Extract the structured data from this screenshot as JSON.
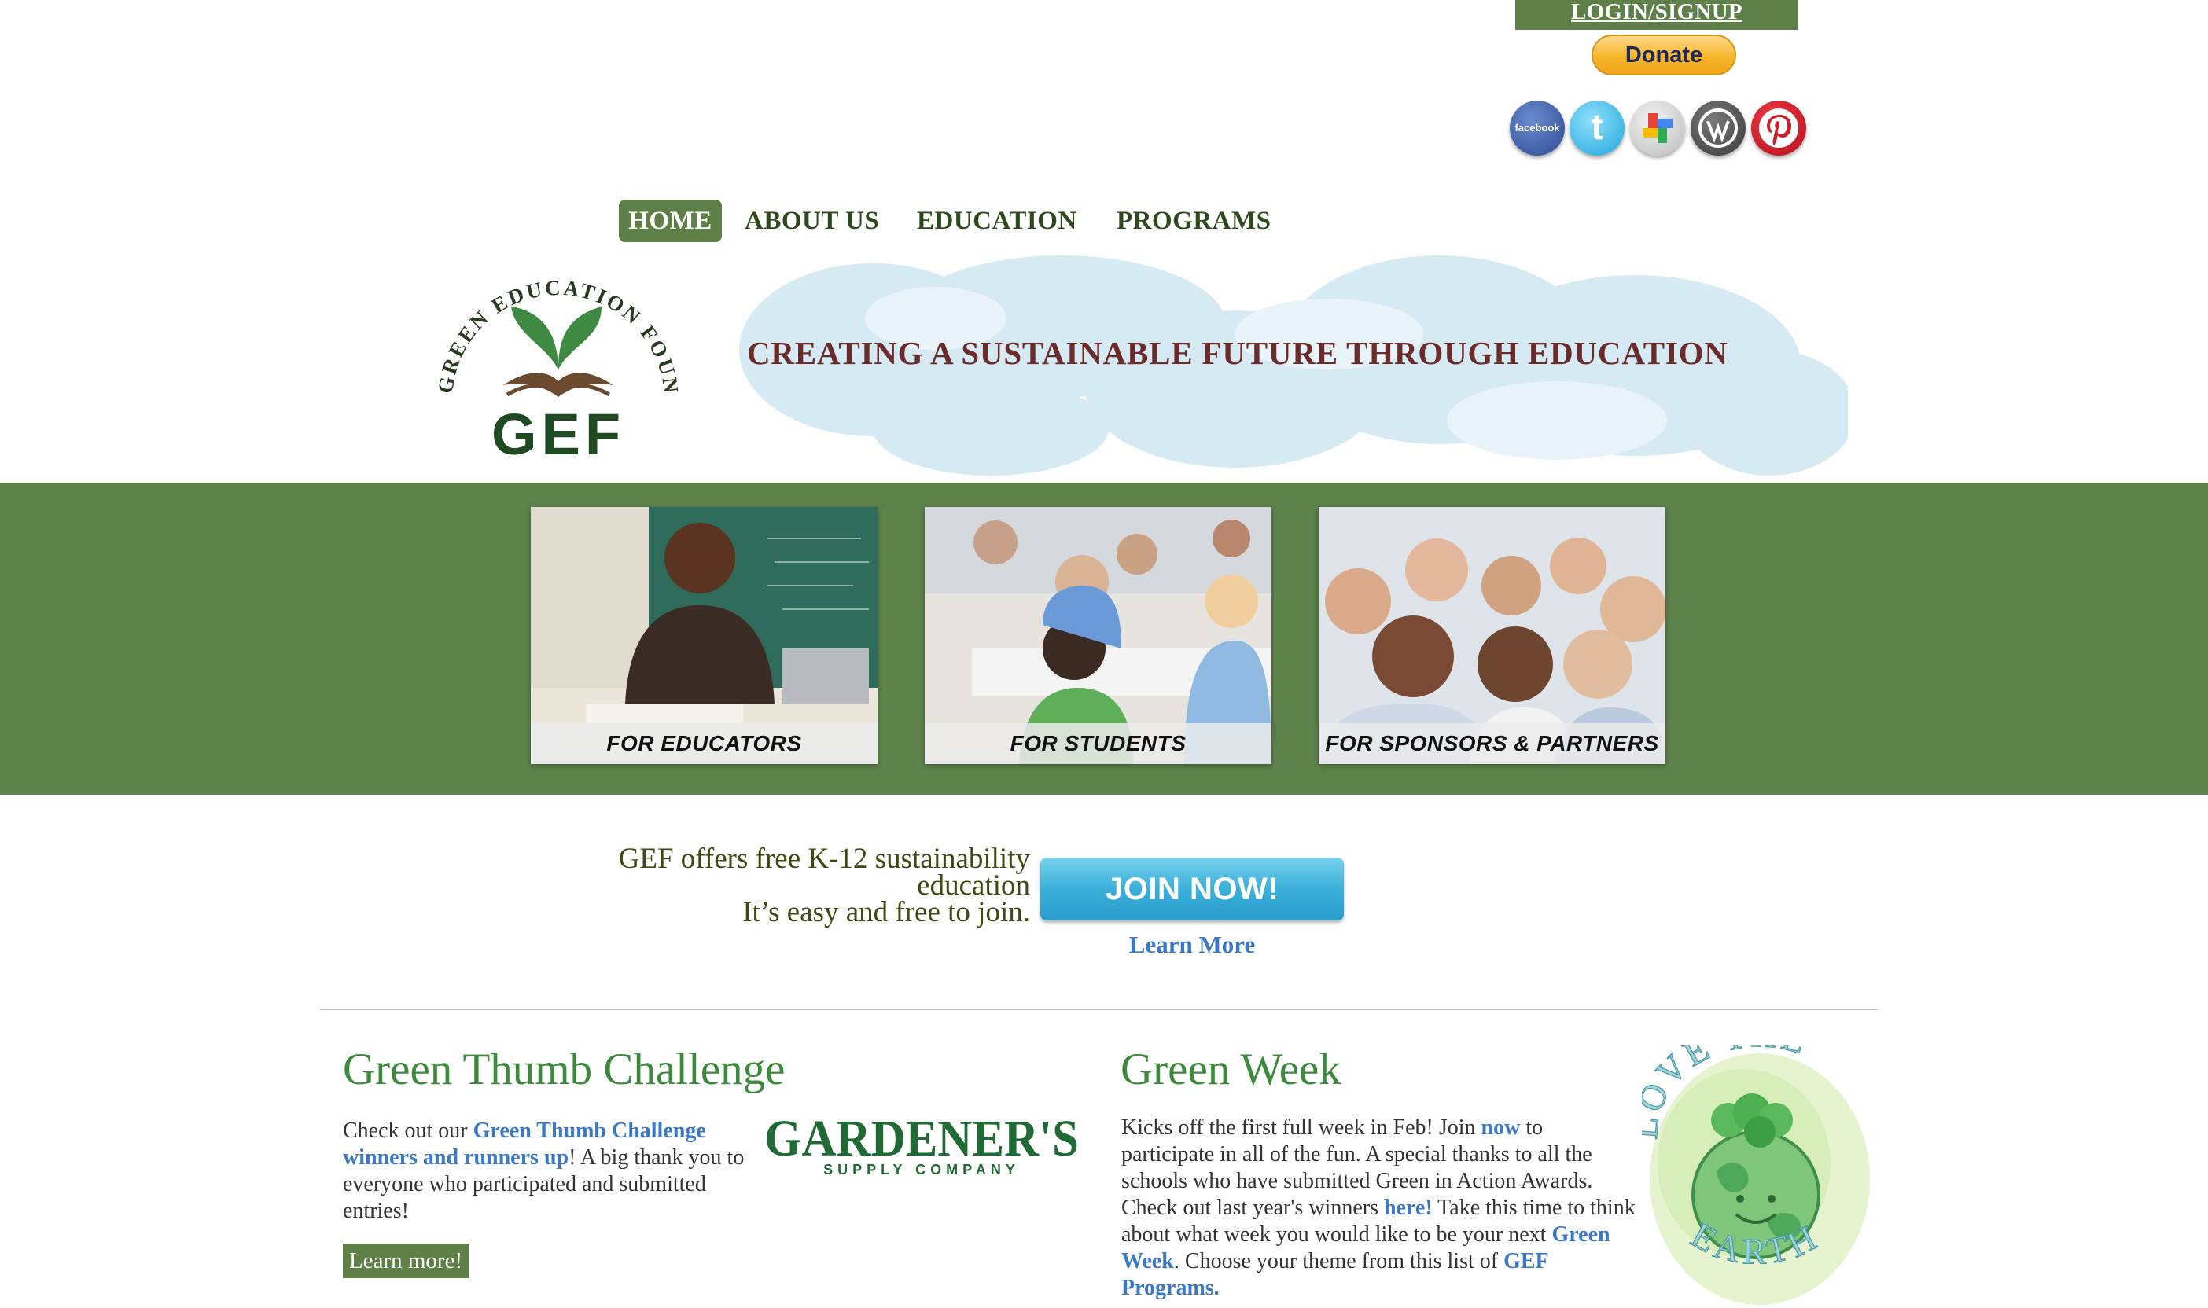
{
  "utility": {
    "login_label": "LOGIN/SIGNUP",
    "donate_label": "Donate",
    "social": [
      "facebook",
      "twitter",
      "google-plus",
      "wordpress",
      "pinterest"
    ],
    "facebook_text": "facebook",
    "twitter_text": "t"
  },
  "nav": {
    "items": [
      {
        "label": "HOME",
        "active": true
      },
      {
        "label": "ABOUT US",
        "active": false
      },
      {
        "label": "EDUCATION",
        "active": false
      },
      {
        "label": "PROGRAMS",
        "active": false
      }
    ]
  },
  "banner": {
    "logo_arc_text": "GREEN EDUCATION FOUNDATION",
    "logo_text": "GEF",
    "tagline": "CREATING A SUSTAINABLE FUTURE THROUGH EDUCATION"
  },
  "cards": [
    {
      "label": "FOR EDUCATORS"
    },
    {
      "label": "FOR STUDENTS"
    },
    {
      "label": "FOR SPONSORS & PARTNERS"
    }
  ],
  "join": {
    "line1": "GEF offers free K-12 sustainability",
    "line2": "education",
    "line3": "It’s easy and free to join.",
    "button": "JOIN NOW!",
    "learn_more": "Learn More"
  },
  "green_thumb": {
    "title": "Green Thumb Challenge",
    "text_before": "Check out our ",
    "link": "Green Thumb Challenge winners and runners up",
    "text_after": "! A big thank you to everyone who participated and submitted entries!",
    "sponsor_name": "GARDENER'S",
    "sponsor_sub": "SUPPLY COMPANY",
    "learn_more": "Learn more!"
  },
  "green_week": {
    "title": "Green Week",
    "t1": "Kicks off the first full week in Feb! Join ",
    "link_now": "now",
    "t2": " to participate in all of the fun. A special thanks to all the schools who have submitted Green in Action Awards. Check out last year's winners ",
    "link_here": "here!",
    "t3": " Take this time to think about what week you would like to be your next ",
    "link_gw": "Green Week",
    "t4": ".  Choose your theme from this list of ",
    "link_programs": "GEF Programs.",
    "image_text_top": "LOVE THE",
    "image_text_bottom": "EARTH"
  },
  "colors": {
    "nav_green": "#5e7f48",
    "band_green": "#5e824c",
    "heading_green": "#3c8a3c",
    "link_blue": "#3b78c5",
    "tagline_maroon": "#6b2b2b"
  }
}
